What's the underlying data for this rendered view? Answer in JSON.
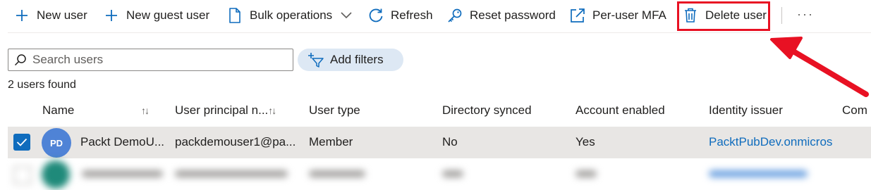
{
  "toolbar": {
    "new_user": "New user",
    "new_guest_user": "New guest user",
    "bulk_operations": "Bulk operations",
    "refresh": "Refresh",
    "reset_password": "Reset password",
    "per_user_mfa": "Per-user MFA",
    "delete_user": "Delete user",
    "more": "···"
  },
  "icons": {
    "new_user": "plus-icon",
    "new_guest_user": "plus-icon",
    "bulk_operations": "document-icon",
    "bulk_chevron": "chevron-down-icon",
    "refresh": "refresh-icon",
    "reset_password": "key-icon",
    "per_user_mfa": "external-link-icon",
    "delete_user": "trash-icon",
    "search": "search-icon",
    "add_filters": "filter-add-icon",
    "annotation": "red-arrow-icon"
  },
  "search": {
    "placeholder": "Search users",
    "value": ""
  },
  "filters": {
    "label": "Add filters"
  },
  "results": {
    "count_text": "2 users found"
  },
  "table": {
    "columns": [
      {
        "label": "Name",
        "sort": "↑↓"
      },
      {
        "label": "User principal n...",
        "sort": "↑↓"
      },
      {
        "label": "User type"
      },
      {
        "label": "Directory synced"
      },
      {
        "label": "Account enabled"
      },
      {
        "label": "Identity issuer"
      },
      {
        "label": "Com"
      }
    ],
    "rows": [
      {
        "selected": true,
        "initials": "PD",
        "name": "Packt DemoU...",
        "upn": "packdemouser1@pa...",
        "user_type": "Member",
        "directory_synced": "No",
        "account_enabled": "Yes",
        "identity_issuer": "PacktPubDev.onmicros"
      }
    ]
  },
  "colors": {
    "accent": "#0f6cbd",
    "avatar": "#4f83d6",
    "highlight": "#e81123",
    "selected_row": "#e8e6e4",
    "filter_pill": "#dde8f4"
  }
}
